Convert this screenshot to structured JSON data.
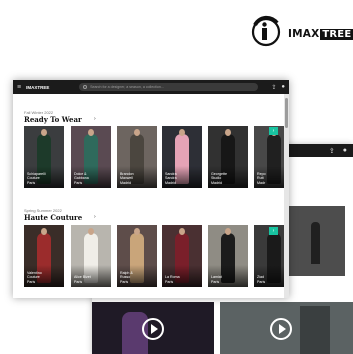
{
  "brand": {
    "name_first": "IMAX",
    "name_second": "TREE"
  },
  "browser": {
    "logo_text": "IMAXTREE",
    "search_placeholder": "Search for a designer, a season, a collection...",
    "icons": [
      "menu-icon",
      "search-icon",
      "upload-icon",
      "user-icon"
    ]
  },
  "sections": [
    {
      "season": "Fall Winter 2022",
      "title": "Ready To Wear",
      "cards": [
        {
          "label": "Schiaparelli\nCouture\nParis",
          "bg": "#3b3d3f",
          "fig": "#1d3a2a"
        },
        {
          "label": "Dolce &\nGabbana\nParis",
          "bg": "#5a4a52",
          "fig": "#2f6a5c"
        },
        {
          "label": "Brandon\nMaxwell\nMadrid",
          "bg": "#6d6560",
          "fig": "#4b463f"
        },
        {
          "label": "Sandra\nSandra\nMadrid",
          "bg": "#2d2f36",
          "fig": "#e5a3b6"
        },
        {
          "label": "Georgette\nStudio\nMadrid",
          "bg": "#313131",
          "fig": "#171717"
        },
        {
          "label": "Repo\nRutt\nMadr",
          "bg": "#484848",
          "fig": "#202020"
        }
      ]
    },
    {
      "season": "Spring Summer 2022",
      "title": "Haute Couture",
      "cards": [
        {
          "label": "Valentino\nCouture\nParis",
          "bg": "#3a2d28",
          "fig": "#9b2c2c"
        },
        {
          "label": "Alice Bizet\nParis",
          "bg": "#b8b5ae",
          "fig": "#f0eee8"
        },
        {
          "label": "Ralph &\nRusso\nParis",
          "bg": "#5e4d4a",
          "fig": "#c9a57a"
        },
        {
          "label": "La Roma\nParis",
          "bg": "#4a3032",
          "fig": "#7a1f2a"
        },
        {
          "label": "Lamiat\nParis",
          "bg": "#8f8c84",
          "fig": "#1c1c1c"
        },
        {
          "label": "Ziad\nParis",
          "bg": "#3a3a3a",
          "fig": "#1a1a1a"
        }
      ]
    }
  ],
  "colors": {
    "accent": "#18c3a0",
    "topbar": "#1b1b1b"
  }
}
